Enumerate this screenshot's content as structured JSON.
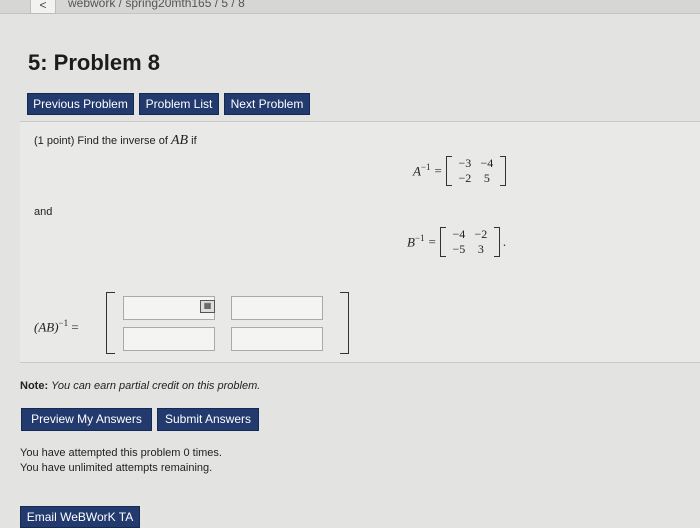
{
  "browser": {
    "back_label": "<",
    "breadcrumb": "webwork / spring20mth165 / 5 / 8"
  },
  "page": {
    "title": "5: Problem 8"
  },
  "nav": {
    "previous": "Previous Problem",
    "list": "Problem List",
    "next": "Next Problem"
  },
  "problem": {
    "points": "(1 point) Find the inverse of",
    "product": "AB",
    "if": "if",
    "and": "and",
    "a_inv": {
      "lhs": "A",
      "sup": "−1",
      "eq": "=",
      "cells": [
        "−3",
        "−4",
        "−2",
        "5"
      ]
    },
    "b_inv": {
      "lhs": "B",
      "sup": "−1",
      "eq": "=",
      "cells": [
        "−4",
        "−2",
        "−5",
        "3"
      ],
      "period": "."
    },
    "answer": {
      "lhs": "(AB)",
      "sup": "−1",
      "eq": "=",
      "inputs": [
        "",
        "",
        "",
        ""
      ]
    }
  },
  "note": {
    "label": "Note:",
    "text": "You can earn partial credit on this problem."
  },
  "actions": {
    "preview": "Preview My Answers",
    "submit": "Submit Answers"
  },
  "status": {
    "attempted": "You have attempted this problem 0 times.",
    "remaining": "You have unlimited attempts remaining."
  },
  "footer": {
    "email": "Email WeBWorK TA"
  },
  "colors": {
    "button_bg": "#223a6e",
    "page_bg": "#e3e3e1"
  },
  "icons": {
    "keyboard": "equation-editor-icon",
    "back": "chevron-left-icon"
  }
}
